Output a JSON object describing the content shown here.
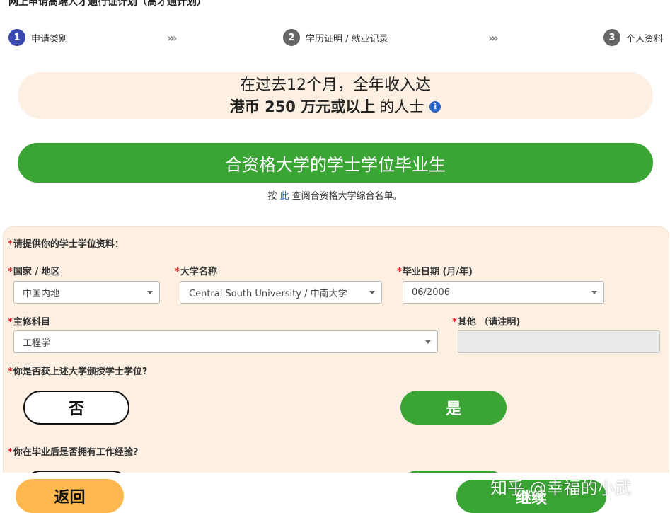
{
  "page": {
    "title": "网上申请高端人才通行证计划（高才通计划）"
  },
  "steps": [
    {
      "number": "1",
      "label": "申请类别"
    },
    {
      "number": "2",
      "label": "学历证明 / 就业记录"
    },
    {
      "number": "3",
      "label": "个人资料"
    }
  ],
  "step_separator": "»»",
  "income": {
    "line1": "在过去12个月，全年收入达",
    "line2_bold": "港币 250 万元或以上",
    "line2_rest": "的人士",
    "info_icon": "i"
  },
  "grad_button": {
    "label": "合资格大学的学士学位毕业生"
  },
  "list_note": {
    "prefix": "按",
    "link": "此",
    "suffix": "查阅合资格大学综合名单。"
  },
  "form": {
    "required_mark": "*",
    "section_title": "请提供你的学士学位资料：",
    "country": {
      "label": "国家 / 地区",
      "value": "中国内地"
    },
    "university": {
      "label": "大学名称",
      "value": "Central South University / 中南大学"
    },
    "grad_date": {
      "label": "毕业日期 (月/年)",
      "value": "06/2006"
    },
    "major": {
      "label": "主修科目",
      "value": "工程学"
    },
    "other": {
      "label": "其他 （请注明)",
      "value": ""
    },
    "degree_question": {
      "label": "你是否获上述大学颁授学士学位?",
      "no": "否",
      "yes": "是"
    },
    "work_question": {
      "label": "你在毕业后是否拥有工作经验?"
    }
  },
  "footer": {
    "back_label": "返回",
    "continue_label": "继续",
    "watermark": "知乎 @幸福的小武"
  }
}
